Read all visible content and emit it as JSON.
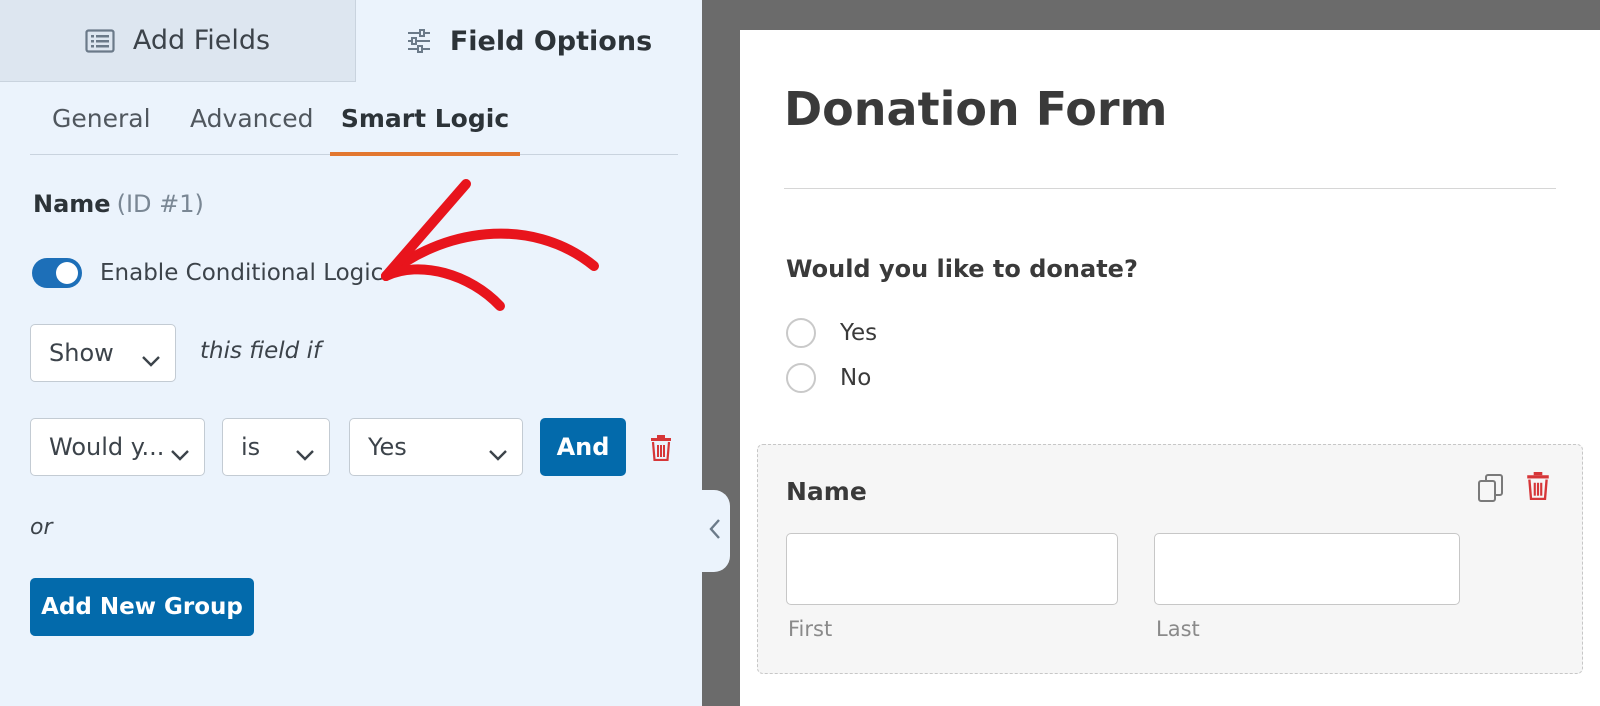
{
  "top_tabs": {
    "add_fields": {
      "label": "Add Fields",
      "icon": "list-icon"
    },
    "field_options": {
      "label": "Field Options",
      "icon": "sliders-icon"
    }
  },
  "sub_tabs": {
    "general": "General",
    "advanced": "Advanced",
    "smart_logic": "Smart Logic",
    "active": "Smart Logic"
  },
  "field": {
    "name": "Name",
    "id_label": "(ID #1)"
  },
  "conditional": {
    "toggle_label": "Enable Conditional Logic",
    "toggle_on": true,
    "action_value": "Show",
    "action_suffix": "this field if",
    "rule": {
      "field": "Would y...",
      "operator": "is",
      "value": "Yes"
    },
    "and_label": "And",
    "or_label": "or",
    "add_group_label": "Add New Group"
  },
  "preview": {
    "title": "Donation Form",
    "question": "Would you like to donate?",
    "options": [
      "Yes",
      "No"
    ],
    "name_field": {
      "label": "Name",
      "sublabels": [
        "First",
        "Last"
      ]
    }
  },
  "colors": {
    "accent_blue": "#036aab",
    "toggle_blue": "#1d6fb8",
    "tab_underline": "#e27730",
    "annotation_red": "#e8141c",
    "delete_red": "#d63638"
  }
}
